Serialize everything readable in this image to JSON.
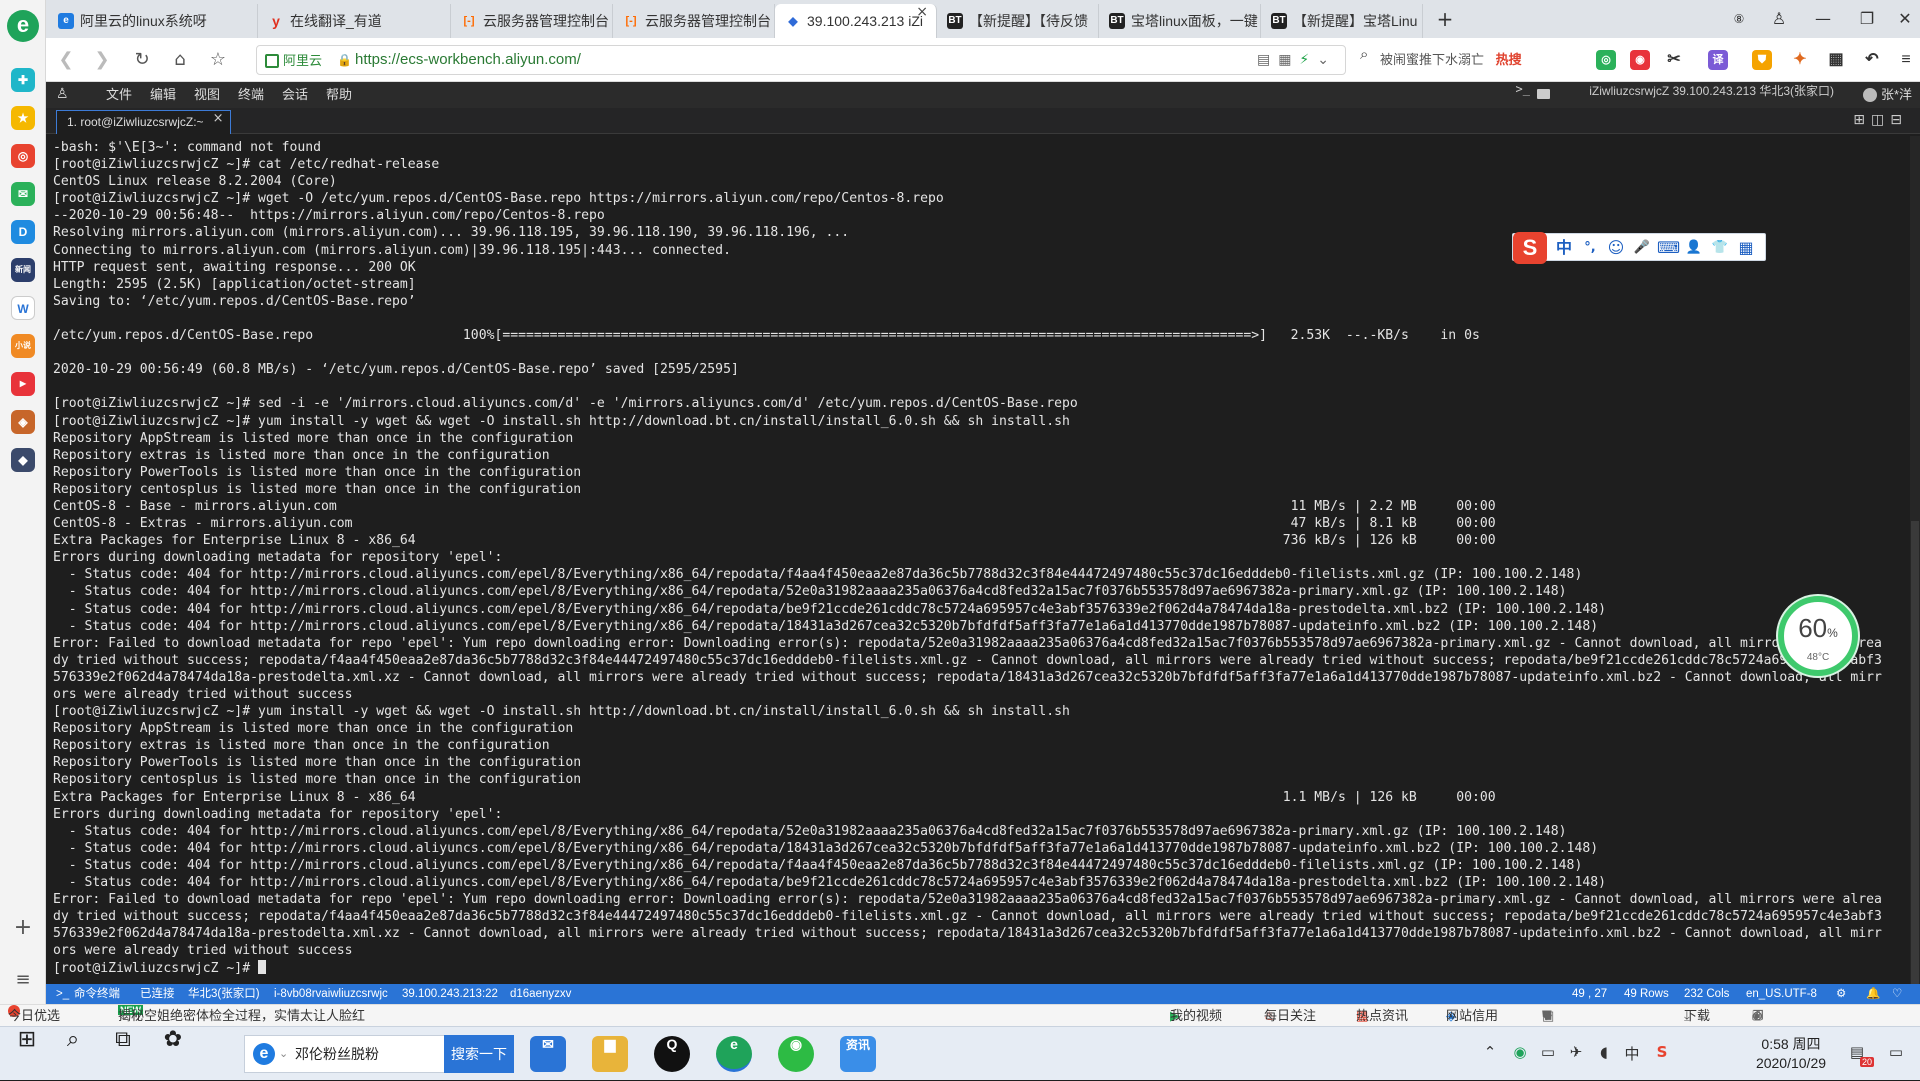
{
  "browser": {
    "tabs": [
      {
        "label": "阿里云的linux系统呀",
        "fav": "e",
        "color": "#1f7be0"
      },
      {
        "label": "在线翻译_有道",
        "fav": "y",
        "color": "#e0301e"
      },
      {
        "label": "云服务器管理控制台",
        "fav": "[-]",
        "color": "#ff6a00"
      },
      {
        "label": "云服务器管理控制台",
        "fav": "[-]",
        "color": "#ff6a00"
      },
      {
        "label": "39.100.243.213 iZi",
        "fav": "◆",
        "color": "#2f6bd8",
        "active": true
      },
      {
        "label": "【新提醒】【待反馈",
        "fav": "BT",
        "color": "#222"
      },
      {
        "label": "宝塔linux面板，一键",
        "fav": "BT",
        "color": "#222"
      },
      {
        "label": "【新提醒】宝塔Linu",
        "fav": "BT",
        "color": "#222"
      }
    ],
    "tab_close": "×",
    "new_tab": "+",
    "site_badge": "阿里云",
    "url": "https://ecs-workbench.aliyun.com/",
    "search_hint": "被闹蜜推下水溺亡",
    "search_hot": "热搜",
    "status_left": [
      {
        "text": "今日优选"
      },
      {
        "text": "揭秘空姐绝密体检全过程，实情太让人脸红",
        "badge": "NEW"
      }
    ],
    "status_right": [
      "我的视频",
      "每日关注",
      "热点资讯",
      "网站信用",
      "下载"
    ]
  },
  "terminal_app": {
    "menu": [
      "文件",
      "编辑",
      "视图",
      "终端",
      "会话",
      "帮助"
    ],
    "session_info": "iZiwliuzcsrwjcZ 39.100.243.213 华北3(张家口)",
    "user": "张*洋",
    "tab_label": "1. root@iZiwliuzcsrwjcZ:~",
    "status_bar": {
      "mode": "命令终端",
      "connection": "已连接",
      "region": "华北3(张家口)",
      "instance": "i-8vb08rvaiwliuzcsrwjc",
      "endpoint": "39.100.243.213:22",
      "session": "d16aenyzxv",
      "cursor_pos": "49 , 27",
      "rows": "49 Rows",
      "cols": "232 Cols",
      "encoding": "en_US.UTF-8"
    },
    "lines": [
      "-bash: $'\\E[3~': command not found",
      "[root@iZiwliuzcsrwjcZ ~]# cat /etc/redhat-release",
      "CentOS Linux release 8.2.2004 (Core)",
      "[root@iZiwliuzcsrwjcZ ~]# wget -O /etc/yum.repos.d/CentOS-Base.repo https://mirrors.aliyun.com/repo/Centos-8.repo",
      "--2020-10-29 00:56:48--  https://mirrors.aliyun.com/repo/Centos-8.repo",
      "Resolving mirrors.aliyun.com (mirrors.aliyun.com)... 39.96.118.195, 39.96.118.190, 39.96.118.196, ...",
      "Connecting to mirrors.aliyun.com (mirrors.aliyun.com)|39.96.118.195|:443... connected.",
      "HTTP request sent, awaiting response... 200 OK",
      "Length: 2595 (2.5K) [application/octet-stream]",
      "Saving to: ‘/etc/yum.repos.d/CentOS-Base.repo’",
      "",
      "/etc/yum.repos.d/CentOS-Base.repo                   100%[===============================================================================================>]   2.53K  --.-KB/s    in 0s",
      "",
      "2020-10-29 00:56:49 (60.8 MB/s) - ‘/etc/yum.repos.d/CentOS-Base.repo’ saved [2595/2595]",
      "",
      "[root@iZiwliuzcsrwjcZ ~]# sed -i -e '/mirrors.cloud.aliyuncs.com/d' -e '/mirrors.aliyuncs.com/d' /etc/yum.repos.d/CentOS-Base.repo",
      "[root@iZiwliuzcsrwjcZ ~]# yum install -y wget && wget -O install.sh http://download.bt.cn/install/install_6.0.sh && sh install.sh",
      "Repository AppStream is listed more than once in the configuration",
      "Repository extras is listed more than once in the configuration",
      "Repository PowerTools is listed more than once in the configuration",
      "Repository centosplus is listed more than once in the configuration",
      "CentOS-8 - Base - mirrors.aliyun.com                                                                                                                         11 MB/s | 2.2 MB     00:00",
      "CentOS-8 - Extras - mirrors.aliyun.com                                                                                                                       47 kB/s | 8.1 kB     00:00",
      "Extra Packages for Enterprise Linux 8 - x86_64                                                                                                              736 kB/s | 126 kB     00:00",
      "Errors during downloading metadata for repository 'epel':",
      "  - Status code: 404 for http://mirrors.cloud.aliyuncs.com/epel/8/Everything/x86_64/repodata/f4aa4f450eaa2e87da36c5b7788d32c3f84e44472497480c55c37dc16edddeb0-filelists.xml.gz (IP: 100.100.2.148)",
      "  - Status code: 404 for http://mirrors.cloud.aliyuncs.com/epel/8/Everything/x86_64/repodata/52e0a31982aaaa235a06376a4cd8fed32a15ac7f0376b553578d97ae6967382a-primary.xml.gz (IP: 100.100.2.148)",
      "  - Status code: 404 for http://mirrors.cloud.aliyuncs.com/epel/8/Everything/x86_64/repodata/be9f21ccde261cddc78c5724a695957c4e3abf3576339e2f062d4a78474da18a-prestodelta.xml.bz2 (IP: 100.100.2.148)",
      "  - Status code: 404 for http://mirrors.cloud.aliyuncs.com/epel/8/Everything/x86_64/repodata/18431a3d267cea32c5320b7bfdfdf5aff3fa77e1a6a1d413770dde1987b78087-updateinfo.xml.bz2 (IP: 100.100.2.148)",
      "Error: Failed to download metadata for repo 'epel': Yum repo downloading error: Downloading error(s): repodata/52e0a31982aaaa235a06376a4cd8fed32a15ac7f0376b553578d97ae6967382a-primary.xml.gz - Cannot download, all mirrors were alrea",
      "dy tried without success; repodata/f4aa4f450eaa2e87da36c5b7788d32c3f84e44472497480c55c37dc16edddeb0-filelists.xml.gz - Cannot download, all mirrors were already tried without success; repodata/be9f21ccde261cddc78c5724a695957c4e3abf3",
      "576339e2f062d4a78474da18a-prestodelta.xml.xz - Cannot download, all mirrors were already tried without success; repodata/18431a3d267cea32c5320b7bfdfdf5aff3fa77e1a6a1d413770dde1987b78087-updateinfo.xml.bz2 - Cannot download, all mirr",
      "ors were already tried without success",
      "[root@iZiwliuzcsrwjcZ ~]# yum install -y wget && wget -O install.sh http://download.bt.cn/install/install_6.0.sh && sh install.sh",
      "Repository AppStream is listed more than once in the configuration",
      "Repository extras is listed more than once in the configuration",
      "Repository PowerTools is listed more than once in the configuration",
      "Repository centosplus is listed more than once in the configuration",
      "Extra Packages for Enterprise Linux 8 - x86_64                                                                                                              1.1 MB/s | 126 kB     00:00",
      "Errors during downloading metadata for repository 'epel':",
      "  - Status code: 404 for http://mirrors.cloud.aliyuncs.com/epel/8/Everything/x86_64/repodata/52e0a31982aaaa235a06376a4cd8fed32a15ac7f0376b553578d97ae6967382a-primary.xml.gz (IP: 100.100.2.148)",
      "  - Status code: 404 for http://mirrors.cloud.aliyuncs.com/epel/8/Everything/x86_64/repodata/18431a3d267cea32c5320b7bfdfdf5aff3fa77e1a6a1d413770dde1987b78087-updateinfo.xml.bz2 (IP: 100.100.2.148)",
      "  - Status code: 404 for http://mirrors.cloud.aliyuncs.com/epel/8/Everything/x86_64/repodata/f4aa4f450eaa2e87da36c5b7788d32c3f84e44472497480c55c37dc16edddeb0-filelists.xml.gz (IP: 100.100.2.148)",
      "  - Status code: 404 for http://mirrors.cloud.aliyuncs.com/epel/8/Everything/x86_64/repodata/be9f21ccde261cddc78c5724a695957c4e3abf3576339e2f062d4a78474da18a-prestodelta.xml.bz2 (IP: 100.100.2.148)",
      "Error: Failed to download metadata for repo 'epel': Yum repo downloading error: Downloading error(s): repodata/52e0a31982aaaa235a06376a4cd8fed32a15ac7f0376b553578d97ae6967382a-primary.xml.gz - Cannot download, all mirrors were alrea",
      "dy tried without success; repodata/f4aa4f450eaa2e87da36c5b7788d32c3f84e44472497480c55c37dc16edddeb0-filelists.xml.gz - Cannot download, all mirrors were already tried without success; repodata/be9f21ccde261cddc78c5724a695957c4e3abf3",
      "576339e2f062d4a78474da18a-prestodelta.xml.xz - Cannot download, all mirrors were already tried without success; repodata/18431a3d267cea32c5320b7bfdfdf5aff3fa77e1a6a1d413770dde1987b78087-updateinfo.xml.bz2 - Cannot download, all mirr",
      "ors were already tried without success"
    ],
    "prompt": "[root@iZiwliuzcsrwjcZ ~]# "
  },
  "ime_toolbar": {
    "logo": "S",
    "items": [
      "中",
      "°,",
      "☺",
      "🎤",
      "⌨",
      "👤",
      "👕",
      "▦"
    ]
  },
  "cpu_widget": {
    "percent": "60",
    "percent_unit": "%",
    "temp": "48°C",
    "ring_color": "#3ec96c"
  },
  "taskbar": {
    "search_text": "邓伦粉丝脱粉",
    "search_button": "搜索一下",
    "time": "0:58 周四",
    "date": "2020/10/29",
    "notif_count": "20",
    "ime": "中",
    "apps": [
      {
        "icon": "mail-icon",
        "label": "✉",
        "color": "#2a74d6"
      },
      {
        "icon": "folder-icon",
        "label": "▆",
        "color": "#e8b43a"
      },
      {
        "icon": "qq-icon",
        "label": "Q",
        "color": "#111"
      },
      {
        "icon": "browser-icon",
        "label": "e",
        "color": "#1fa35a"
      },
      {
        "icon": "wechat-icon",
        "label": "◉",
        "color": "#2dbb44"
      },
      {
        "icon": "news-icon",
        "label": "资讯",
        "color": "#3a8ee8"
      }
    ]
  },
  "colors": {
    "terminal_bg": "#1e1e1e",
    "terminal_fg": "#e4e4e4",
    "status_bar": "#2a74d6",
    "accent_green": "#1fa35a"
  }
}
